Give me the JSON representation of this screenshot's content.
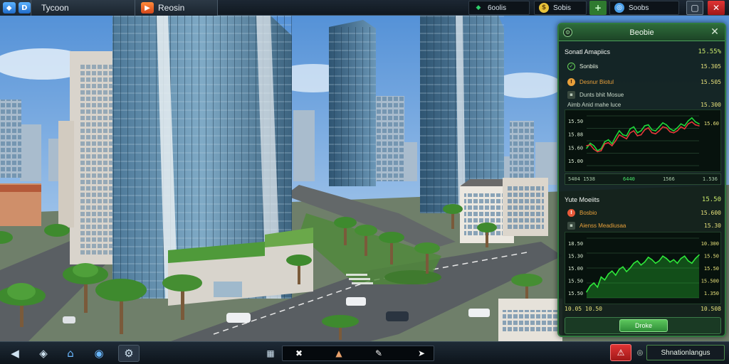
{
  "topbar": {
    "tabs": [
      {
        "label": "Tycoon",
        "icon": "cube-icon"
      },
      {
        "label": "Reosin",
        "icon": "play-flag-icon"
      }
    ],
    "resources": [
      {
        "label": "6oolis",
        "icon": "gem-icon",
        "color": "#2ed06a"
      },
      {
        "label": "Sobis",
        "icon": "coin-icon",
        "color": "#e8c23a"
      },
      {
        "label": "Soobs",
        "icon": "globe-icon",
        "color": "#4a9ee8"
      }
    ],
    "resource_add": "+"
  },
  "panel": {
    "title": "Beobie",
    "close": "✕",
    "section1": {
      "title": "Sonatl Amapiics",
      "value": "15.55%",
      "rows": [
        {
          "label": "Sonbiis",
          "value": "15.305",
          "icon": "check-icon",
          "color": "#6ad65a"
        },
        {
          "label": "Desnur Biotul",
          "value": "15.505",
          "icon": "warning-icon",
          "color": "#e8a03a"
        },
        {
          "label": "Dunts bhit Mosue",
          "value": ""
        },
        {
          "label": "Aimb Anid mahe luce",
          "value": "15.300"
        }
      ],
      "chart": {
        "y_labels": [
          "15.50",
          "15.88",
          "15.60",
          "15.00"
        ],
        "right_values": [
          "15.60"
        ],
        "gain_labels": [
          "5404 1538",
          "6440",
          "1566",
          "1.536"
        ]
      }
    },
    "section2": {
      "title": "Yute Moeiits",
      "value": "15.50",
      "rows": [
        {
          "label": "Bosbio",
          "value": "15.600",
          "icon": "alert-icon",
          "color": "#e85a3a"
        },
        {
          "label": "Aienss Meadiusaa",
          "value": "15.30"
        }
      ],
      "chart": {
        "y_labels": [
          "18.50",
          "15.30",
          "15.00",
          "15.50",
          "15.50"
        ],
        "right_values": [
          "10.300",
          "15.50",
          "15.50",
          "15.500",
          "1.350"
        ]
      },
      "footnote": {
        "left": "10.05 10.50",
        "right": "10.508"
      }
    },
    "button": "Droke"
  },
  "chart_data": [
    {
      "type": "line",
      "title": "",
      "xlabel": "",
      "ylabel": "",
      "series": [
        {
          "color": "#1fd83a",
          "values": [
            15.35,
            15.45,
            15.4,
            15.3,
            15.34,
            15.48,
            15.52,
            15.44,
            15.58,
            15.7,
            15.62,
            15.6,
            15.74,
            15.78,
            15.66,
            15.7,
            15.8,
            15.82,
            15.72,
            15.7,
            15.78,
            15.86,
            15.82,
            15.74,
            15.7,
            15.76,
            15.84,
            15.8,
            15.9,
            15.96,
            15.88,
            15.84
          ]
        },
        {
          "color": "#e43a3a",
          "values": [
            15.4,
            15.42,
            15.33,
            15.28,
            15.3,
            15.44,
            15.46,
            15.4,
            15.5,
            15.62,
            15.58,
            15.54,
            15.66,
            15.7,
            15.6,
            15.62,
            15.72,
            15.76,
            15.66,
            15.64,
            15.7,
            15.78,
            15.76,
            15.68,
            15.66,
            15.7,
            15.78,
            15.74,
            15.84,
            15.88,
            15.82,
            15.8
          ]
        }
      ],
      "ylim": [
        15.0,
        16.0
      ]
    },
    {
      "type": "area",
      "title": "",
      "xlabel": "",
      "ylabel": "",
      "series": [
        {
          "color": "#2ee83a",
          "values": [
            15.1,
            15.2,
            15.25,
            15.18,
            15.35,
            15.3,
            15.4,
            15.45,
            15.38,
            15.48,
            15.52,
            15.44,
            15.5,
            15.58,
            15.62,
            15.55,
            15.6,
            15.68,
            15.64,
            15.58,
            15.62,
            15.7,
            15.66,
            15.6,
            15.64,
            15.58,
            15.66,
            15.7,
            15.62,
            15.58,
            15.66,
            15.72
          ]
        }
      ],
      "ylim": [
        15.0,
        16.0
      ]
    }
  ],
  "bottombar": {
    "left_tools": [
      "back-icon",
      "cube-build-icon",
      "house-icon",
      "eye-icon",
      "settings-house-icon"
    ],
    "center_tools": [
      "bulldozer-icon",
      "puzzle-icon",
      "brush-icon",
      "pen-icon",
      "wrench-icon"
    ],
    "status": "Shnationlangus"
  }
}
